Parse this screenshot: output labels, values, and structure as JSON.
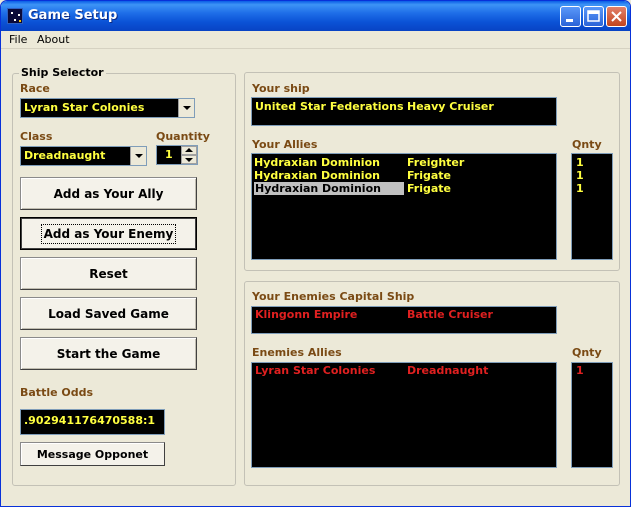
{
  "window": {
    "title": "Game Setup",
    "icon": "starfield-icon"
  },
  "menu": {
    "items": [
      {
        "label": "File"
      },
      {
        "label": "About"
      }
    ]
  },
  "ship_selector": {
    "group_label": "Ship Selector",
    "race_label": "Race",
    "race_value": "Lyran Star Colonies",
    "class_label": "Class",
    "class_value": "Dreadnaught",
    "quantity_label": "Quantity",
    "quantity_value": "1",
    "buttons": {
      "add_ally": "Add as Your Ally",
      "add_enemy": "Add as Your Enemy",
      "reset": "Reset",
      "load_saved": "Load Saved Game",
      "start": "Start the Game"
    },
    "battle_odds_label": "Battle Odds",
    "battle_odds_value": ".902941176470588:1",
    "message_button": "Message Opponet"
  },
  "your_side": {
    "ship_label": "Your ship",
    "ship": {
      "race": "United Star Federations",
      "class": "Heavy Cruiser"
    },
    "allies_label": "Your Allies",
    "qnty_label": "Qnty",
    "allies": [
      {
        "race": "Hydraxian Dominion",
        "class": "Freighter",
        "qnty": "1"
      },
      {
        "race": "Hydraxian Dominion",
        "class": "Frigate",
        "qnty": "1"
      },
      {
        "race": "Hydraxian Dominion",
        "class": "Frigate",
        "qnty": "1"
      }
    ]
  },
  "enemy_side": {
    "capital_label": "Your Enemies Capital Ship",
    "capital": {
      "race": "Klingonn Empire",
      "class": "Battle Cruiser"
    },
    "allies_label": "Enemies Allies",
    "qnty_label": "Qnty",
    "allies": [
      {
        "race": "Lyran Star Colonies",
        "class": "Dreadnaught",
        "qnty": "1"
      }
    ]
  },
  "colors": {
    "text_yellow": "#ffff40",
    "text_red": "#e02020",
    "label_brown": "#7a4a14",
    "titlebar_blue": "#0b52d6"
  }
}
